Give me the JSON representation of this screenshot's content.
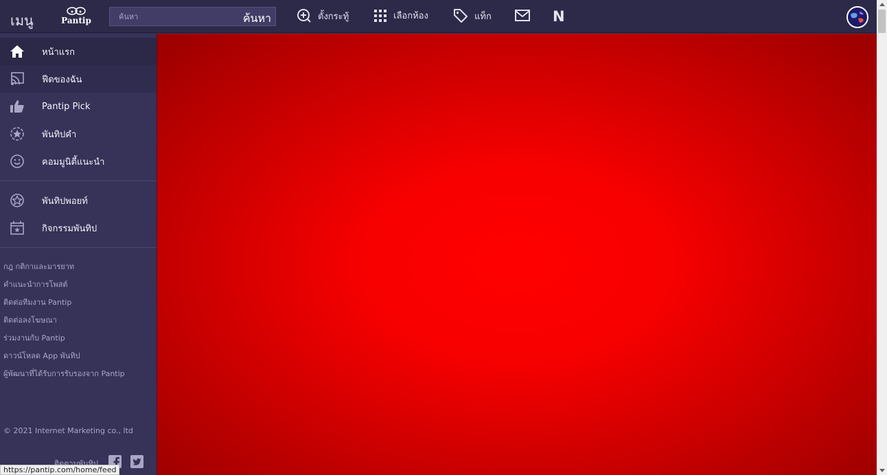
{
  "topbar": {
    "menu_label": "เมนู",
    "logo_text": "Pantip",
    "search": {
      "placeholder": "ค้นหา",
      "button_label": "ค้นหา"
    },
    "nav": [
      {
        "label": "ตั้งกระทู้",
        "icon": "add-circle-icon"
      },
      {
        "label": "เลือกห้อง",
        "icon": "grid-icon"
      },
      {
        "label": "แท็ก",
        "icon": "tag-icon"
      }
    ],
    "mail_icon": "mail-icon",
    "n_badge": "N",
    "avatar_icon": "globe-avatar-icon"
  },
  "sidebar": {
    "primary": [
      {
        "label": "หน้าแรก",
        "icon": "home-icon"
      },
      {
        "label": "ฟีดของฉัน",
        "icon": "feed-icon"
      },
      {
        "label": "Pantip Pick",
        "icon": "thumbs-up-icon"
      },
      {
        "label": "พันทิปคำ",
        "icon": "star-badge-icon"
      },
      {
        "label": "คอมมูนิตี้แนะนำ",
        "icon": "smile-icon"
      }
    ],
    "secondary": [
      {
        "label": "พันทิปพอยท์",
        "icon": "star-circle-icon"
      },
      {
        "label": "กิจกรรมพันทิป",
        "icon": "calendar-star-icon"
      }
    ],
    "links": [
      "กฎ กติกาและมารยาท",
      "คำแนะนำการโพสต์",
      "ติดต่อทีมงาน Pantip",
      "ติดต่อลงโฆษณา",
      "ร่วมงานกับ Pantip",
      "ดาวน์โหลด App พันทิป",
      "ผู้พัฒนาที่ได้รับการรับรองจาก Pantip"
    ],
    "copyright": "© 2021 Internet Marketing co., ltd",
    "follow_label": "ติดตามพันทิป",
    "social": [
      "facebook-icon",
      "twitter-icon"
    ]
  },
  "status_url": "https://pantip.com/home/feed",
  "colors": {
    "topbar": "#2d2a49",
    "sidebar": "#363258",
    "main_center": "#ff0000",
    "main_edge": "#990000"
  }
}
